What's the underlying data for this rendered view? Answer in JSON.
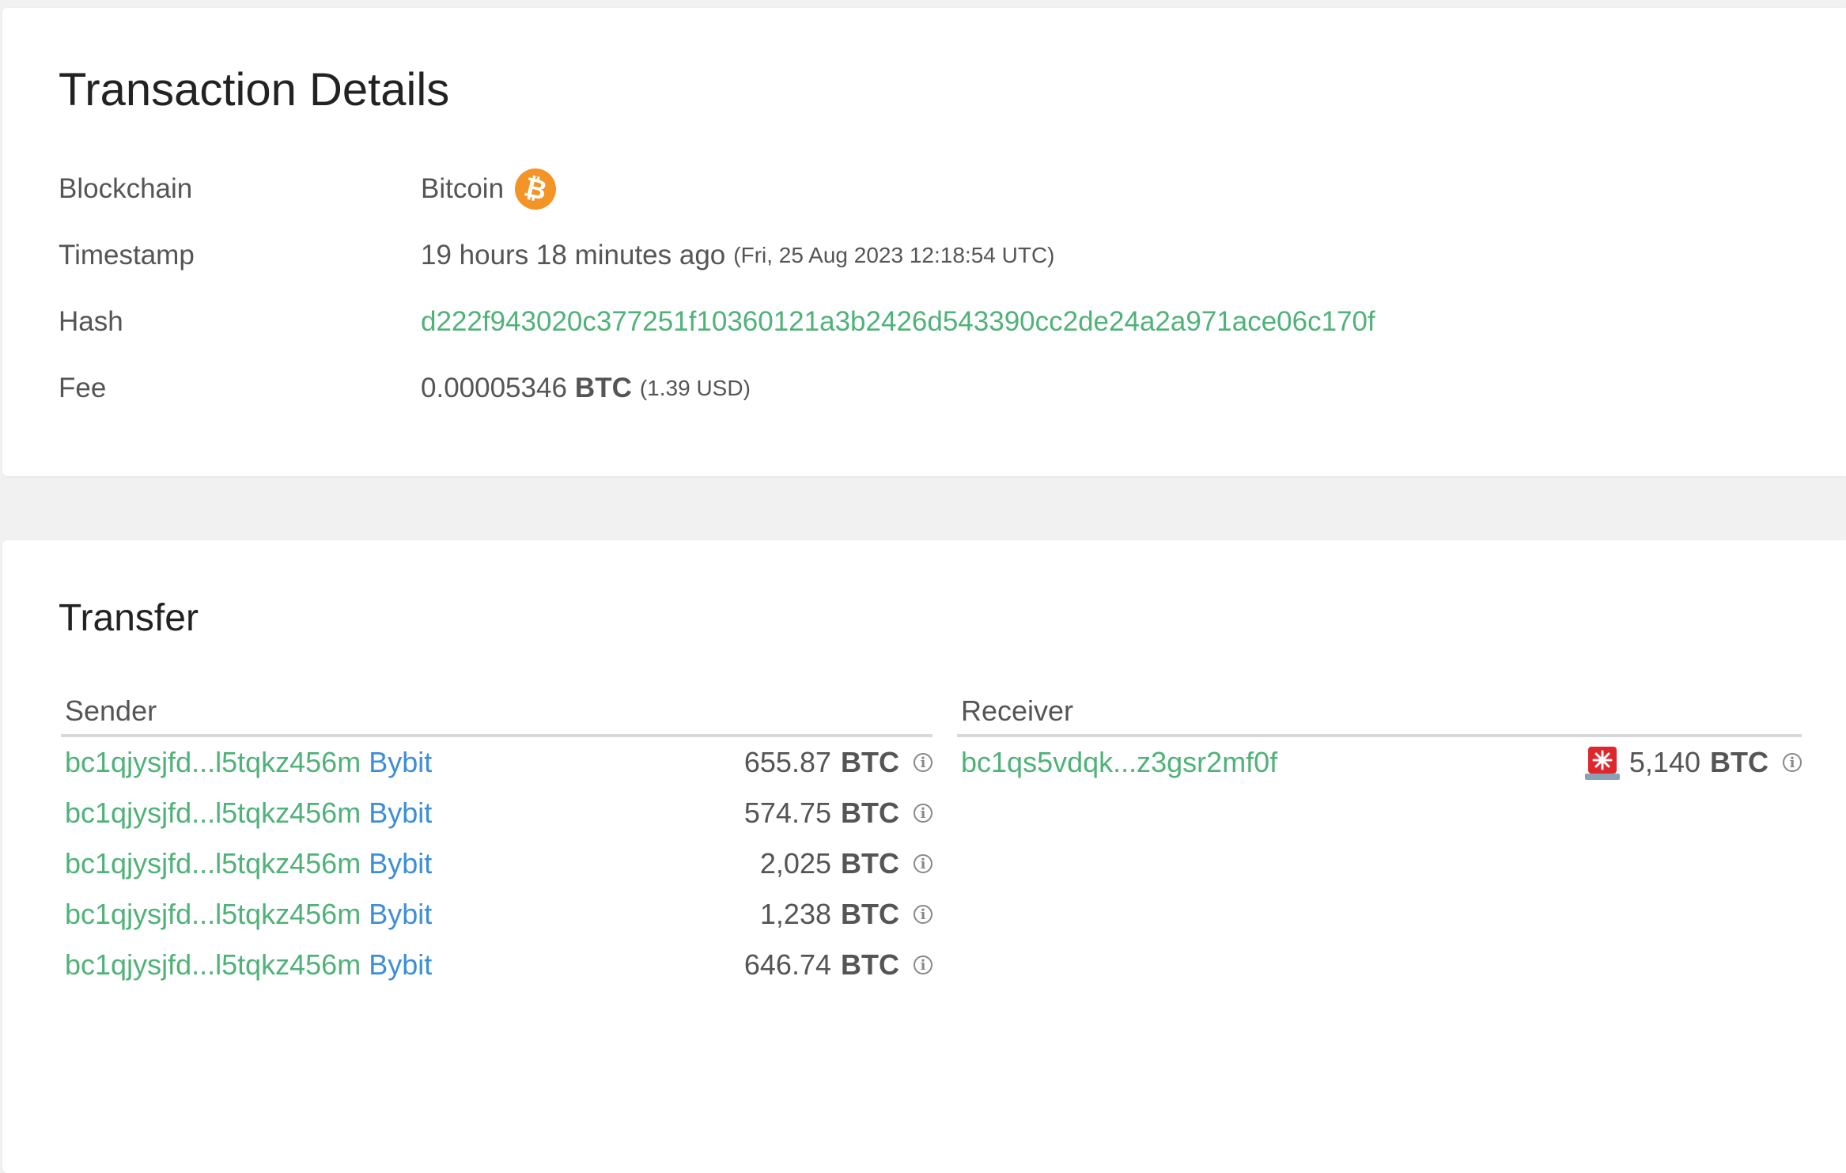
{
  "details": {
    "title": "Transaction Details",
    "rows": {
      "blockchain": {
        "label": "Blockchain",
        "value": "Bitcoin",
        "icon": "bitcoin-icon"
      },
      "timestamp": {
        "label": "Timestamp",
        "relative": "19 hours 18 minutes ago",
        "absolute": "(Fri, 25 Aug 2023 12:18:54 UTC)"
      },
      "hash": {
        "label": "Hash",
        "value": "d222f943020c377251f10360121a3b2426d543390cc2de24a2a971ace06c170f"
      },
      "fee": {
        "label": "Fee",
        "amount": "0.00005346",
        "unit": "BTC",
        "usd": "(1.39 USD)"
      }
    }
  },
  "transfer": {
    "title": "Transfer",
    "sender_header": "Sender",
    "receiver_header": "Receiver",
    "senders": [
      {
        "address": "bc1qjysjfd...l5tqkz456m",
        "tag": "Bybit",
        "amount": "655.87",
        "unit": "BTC"
      },
      {
        "address": "bc1qjysjfd...l5tqkz456m",
        "tag": "Bybit",
        "amount": "574.75",
        "unit": "BTC"
      },
      {
        "address": "bc1qjysjfd...l5tqkz456m",
        "tag": "Bybit",
        "amount": "2,025",
        "unit": "BTC"
      },
      {
        "address": "bc1qjysjfd...l5tqkz456m",
        "tag": "Bybit",
        "amount": "1,238",
        "unit": "BTC"
      },
      {
        "address": "bc1qjysjfd...l5tqkz456m",
        "tag": "Bybit",
        "amount": "646.74",
        "unit": "BTC"
      }
    ],
    "receivers": [
      {
        "address": "bc1qs5vdqk...z3gsr2mf0f",
        "amount": "5,140",
        "unit": "BTC",
        "alert_icon": "alarm-icon"
      }
    ]
  },
  "colors": {
    "link_green": "#4fb278",
    "tag_blue": "#3d8ed9",
    "bitcoin_orange": "#f39427",
    "alarm_red": "#e0262d"
  }
}
